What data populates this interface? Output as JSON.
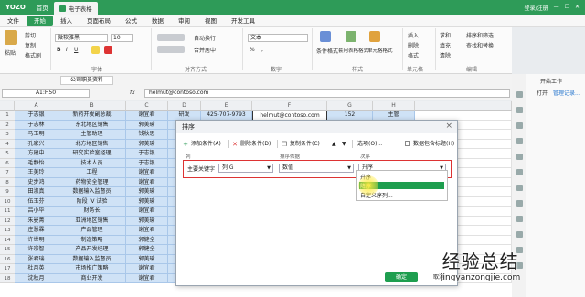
{
  "titlebar": {
    "logo": "YOZO",
    "home": "首页",
    "doc_tab": "电子表格",
    "user": "登录/注册"
  },
  "menu": [
    "文件",
    "开始",
    "插入",
    "页面布局",
    "公式",
    "数据",
    "审阅",
    "视图",
    "开发工具"
  ],
  "ribbon": {
    "paste": "粘贴",
    "cut": "剪切",
    "copy": "复制",
    "format_painter": "格式刷",
    "font_name": "微软雅黑",
    "font_size": "10",
    "font_group": "字体",
    "wrap": "自动换行",
    "merge": "合并居中",
    "align_group": "对齐方式",
    "number_format": "文本",
    "number_group": "数字",
    "cond_format": "条件格式",
    "table_style": "套用表格格式",
    "cell_style": "单元格格式",
    "style_group": "样式",
    "insert": "插入",
    "delete": "删除",
    "format": "格式",
    "cells_group": "单元格",
    "sum": "求和",
    "fill": "填充",
    "clear": "清除",
    "sort_filter": "排序和筛选",
    "find_replace": "查找和替换",
    "edit_group": "编辑"
  },
  "formula_bar": {
    "file_tab": "公司职员资料",
    "name_box": "A1:H50",
    "fx": "fx",
    "formula": "helmut@contoso.com"
  },
  "columns": [
    "A",
    "B",
    "C",
    "D",
    "E",
    "F",
    "G",
    "H"
  ],
  "rows": [
    {
      "n": "1",
      "a": "于志银",
      "b": "新药开发副总裁",
      "c": "谢宜君",
      "d": "研发",
      "e": "425-707-9793",
      "f": "helmut@contoso.com",
      "g": "152",
      "h": "主管"
    },
    {
      "n": "2",
      "a": "于志林",
      "b": "东北地区销售",
      "c": "郭美瑜"
    },
    {
      "n": "3",
      "a": "马玉明",
      "b": "主管助理",
      "c": "钱秋思"
    },
    {
      "n": "4",
      "a": "孔家兴",
      "b": "北方地区销售",
      "c": "郭美瑜"
    },
    {
      "n": "5",
      "a": "方建中",
      "b": "研究实验室经理",
      "c": "于志银"
    },
    {
      "n": "6",
      "a": "毛静怡",
      "b": "技术人员",
      "c": "于志银"
    },
    {
      "n": "7",
      "a": "王美玲",
      "b": "工程",
      "c": "谢宜君"
    },
    {
      "n": "8",
      "a": "史步鸿",
      "b": "药物安全管理",
      "c": "谢宜君"
    },
    {
      "n": "9",
      "a": "田淑真",
      "b": "数据输入监督员",
      "c": "郭美瑜"
    },
    {
      "n": "10",
      "a": "伍玉芬",
      "b": "阶段 IV 试验",
      "c": "郭美瑜"
    },
    {
      "n": "11",
      "a": "吕小毕",
      "b": "财务长",
      "c": "谢宜君"
    },
    {
      "n": "12",
      "a": "朱曼菁",
      "b": "亚洲地区销售",
      "c": "郭美瑜"
    },
    {
      "n": "13",
      "a": "庄慧霖",
      "b": "产品管理",
      "c": "谢宜君"
    },
    {
      "n": "14",
      "a": "许世明",
      "b": "制造策略",
      "c": "郭健全"
    },
    {
      "n": "15",
      "a": "许宗智",
      "b": "产品开发经理",
      "c": "郭健全"
    },
    {
      "n": "16",
      "a": "张君瑞",
      "b": "数据输入监督员",
      "c": "郭美瑜"
    },
    {
      "n": "17",
      "a": "杜月英",
      "b": "市场推广策略",
      "c": "谢宜君"
    },
    {
      "n": "18",
      "a": "沈秋月",
      "b": "商业开发",
      "c": "谢宜君"
    }
  ],
  "dialog": {
    "title": "排序",
    "add_condition": "添加条件(A)",
    "delete_condition": "删除条件(D)",
    "copy_condition": "复制条件(C)",
    "options": "选项(O)...",
    "has_header": "数据包含标题(H)",
    "col_header": "列",
    "sort_by_header": "排序依据",
    "order_header": "次序",
    "key_label": "主要关键字",
    "key_value": "列 G",
    "basis_value": "数值",
    "order_value": "升序",
    "order_options": [
      "升序",
      "降序",
      "自定义序列..."
    ],
    "ok": "确定",
    "cancel": "取消"
  },
  "taskpane": {
    "title": "开始工作",
    "open": "打开",
    "manage": "管理记录..."
  },
  "watermark": {
    "line1": "经验总结",
    "line2": "jingyanzongjie.com"
  },
  "colors": {
    "accent": "#2e9b58",
    "selection": "#cfe2f6",
    "highlight": "#1e9e4f",
    "annotation": "#d33333"
  }
}
